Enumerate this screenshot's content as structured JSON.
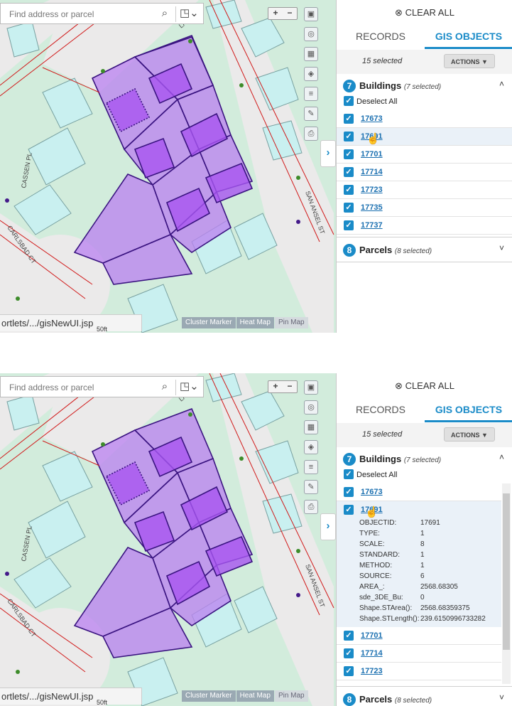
{
  "search": {
    "placeholder": "Find address or parcel"
  },
  "map": {
    "url_text": "ortlets/.../gisNewUI.jsp",
    "scale_label": "50ft",
    "view_tabs": [
      "Cluster Marker",
      "Heat Map",
      "Pin Map"
    ],
    "active_view": "Pin Map",
    "street_labels": [
      "CASSEN PL",
      "CARLSBAD CT",
      "LASSEN",
      "SAN ANSEL ST"
    ],
    "colors": {
      "ground": "#d2ecdc",
      "street": "#ebeaea",
      "lot": "#c9f0f0",
      "selection": "#b980f0",
      "road_line": "#d11a1a"
    }
  },
  "panel": {
    "clear_all": "CLEAR ALL",
    "tabs": [
      {
        "label": "RECORDS",
        "active": false
      },
      {
        "label": "GIS OBJECTS",
        "active": true
      }
    ],
    "selected_count": "15 selected",
    "actions_label": "ACTIONS",
    "buildings": {
      "count": "7",
      "title": "Buildings",
      "subtitle": "(7 selected)",
      "deselect": "Deselect All"
    },
    "building_ids": [
      "17673",
      "17691",
      "17701",
      "17714",
      "17723",
      "17735",
      "17737"
    ],
    "parcels": {
      "count": "8",
      "title": "Parcels",
      "subtitle_top": "(8 selected)",
      "subtitle_bottom": "(8 selected)"
    },
    "details_for": "17691",
    "details": [
      {
        "k": "OBJECTID:",
        "v": "17691"
      },
      {
        "k": "TYPE:",
        "v": "1"
      },
      {
        "k": "SCALE:",
        "v": "8"
      },
      {
        "k": "STANDARD:",
        "v": "1"
      },
      {
        "k": "METHOD:",
        "v": "1"
      },
      {
        "k": "SOURCE:",
        "v": "6"
      },
      {
        "k": "AREA_:",
        "v": "2568.68305"
      },
      {
        "k": "sde_3DE_Bu:",
        "v": "0"
      },
      {
        "k": "Shape.STArea():",
        "v": "2568.68359375"
      },
      {
        "k": "Shape.STLength():",
        "v": "239.6150996733282"
      }
    ]
  }
}
